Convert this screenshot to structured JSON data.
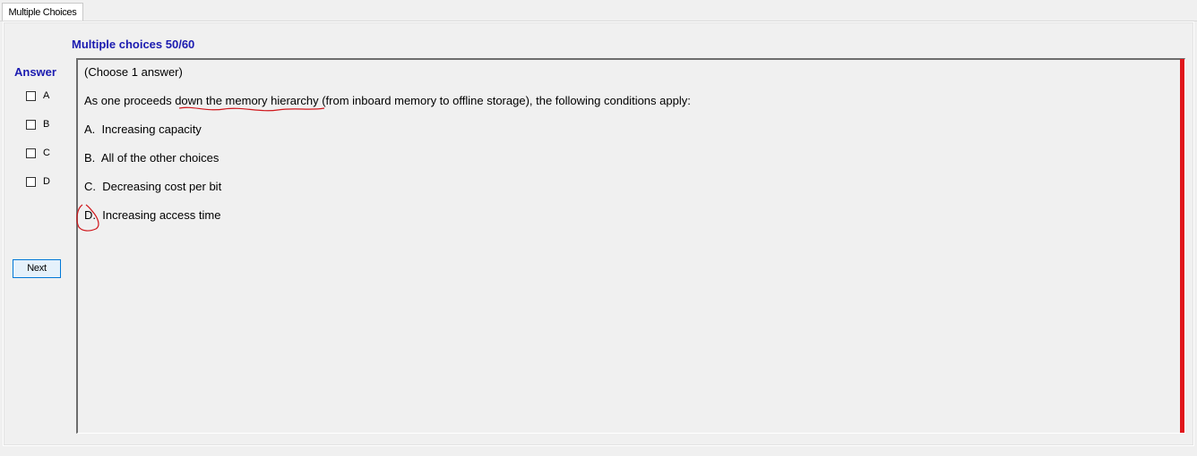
{
  "tab": {
    "label": "Multiple Choices"
  },
  "heading": "Multiple choices 50/60",
  "answer": {
    "label": "Answer",
    "options": [
      "A",
      "B",
      "C",
      "D"
    ]
  },
  "next_label": "Next",
  "question": {
    "instruction": "(Choose 1 answer)",
    "stem_pre": "As one proceeds ",
    "stem_highlight": "down the memory hierarchy",
    "stem_post": " (from inboard memory to offline storage), the following conditions apply:",
    "choices": [
      {
        "letter": "A.",
        "text": "Increasing capacity"
      },
      {
        "letter": "B.",
        "text": "All of the other choices"
      },
      {
        "letter": "C.",
        "text": "Decreasing  cost per bit"
      },
      {
        "letter": "D.",
        "text": "Increasing access time"
      }
    ]
  },
  "colors": {
    "heading": "#1b1bb0",
    "annotation": "#d0161b",
    "scroll_bar": "#e0161b"
  }
}
